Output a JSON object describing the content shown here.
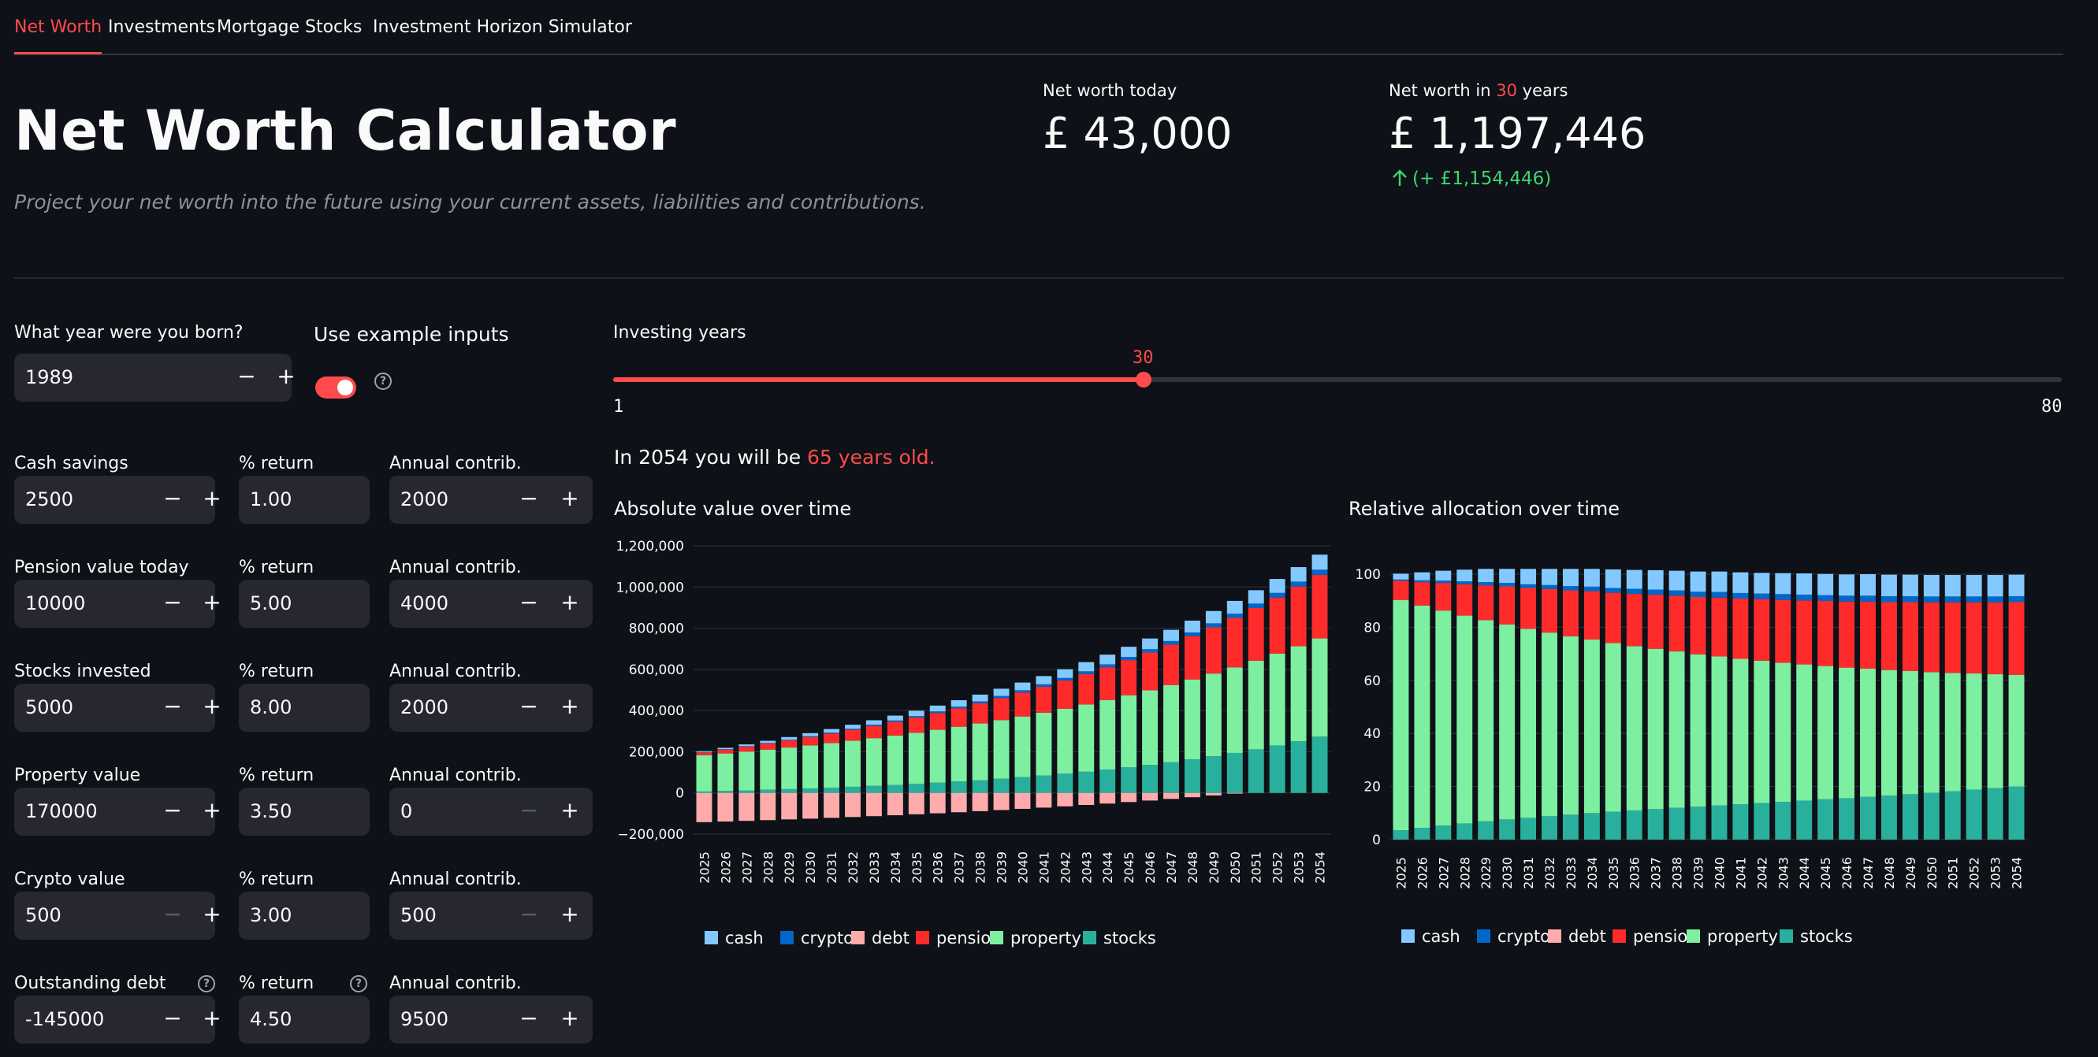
{
  "nav": {
    "tabs": [
      {
        "label": "Net Worth",
        "active": true
      },
      {
        "label": "Investments",
        "active": false
      },
      {
        "label": "Mortgage",
        "active": false
      },
      {
        "label": "Stocks",
        "active": false
      },
      {
        "label": "Investment Horizon Simulator",
        "active": false
      }
    ]
  },
  "header": {
    "title": "Net Worth Calculator",
    "subtitle": "Project your net worth into the future using your current assets, liabilities and contributions."
  },
  "metrics": {
    "today_label": "Net worth today",
    "today_value": "£ 43,000",
    "future_label_pre": "Net worth in ",
    "future_label_years": "30",
    "future_label_post": " years",
    "future_value": "£ 1,197,446",
    "future_delta": "(+ £1,154,446)"
  },
  "inputs": {
    "born_label": "What year were you born?",
    "born_value": "1989",
    "example_label": "Use example inputs",
    "example_enabled": true,
    "return_label": "% return",
    "contrib_label": "Annual contrib.",
    "rows": [
      {
        "label": "Cash savings",
        "value": "2500",
        "ret": "1.00",
        "contrib": "2000",
        "help": false
      },
      {
        "label": "Pension value today",
        "value": "10000",
        "ret": "5.00",
        "contrib": "4000",
        "help": false
      },
      {
        "label": "Stocks invested",
        "value": "5000",
        "ret": "8.00",
        "contrib": "2000",
        "help": false
      },
      {
        "label": "Property value",
        "value": "170000",
        "ret": "3.50",
        "contrib": "0",
        "help": false
      },
      {
        "label": "Crypto value",
        "value": "500",
        "ret": "3.00",
        "contrib": "500",
        "help": false
      },
      {
        "label": "Outstanding debt",
        "value": "-145000",
        "ret": "4.50",
        "contrib": "9500",
        "help": true
      }
    ]
  },
  "slider": {
    "label": "Investing years",
    "value": "30",
    "min": "1",
    "max": "80"
  },
  "age_text": {
    "pre": "In 2054 you will be ",
    "highlight": "65 years old."
  },
  "colors": {
    "accent": "#ff4b4b",
    "positive": "#3dd56d",
    "cash": "#83c9ff",
    "crypto": "#0068c9",
    "debt": "#ffabab",
    "pension": "#ff2b2b",
    "property": "#7defa1",
    "stocks": "#29b09d"
  },
  "chart_data": [
    {
      "type": "bar",
      "stacked": true,
      "title": "Absolute value over time",
      "categories": [
        "2025",
        "2026",
        "2027",
        "2028",
        "2029",
        "2030",
        "2031",
        "2032",
        "2033",
        "2034",
        "2035",
        "2036",
        "2037",
        "2038",
        "2039",
        "2040",
        "2041",
        "2042",
        "2043",
        "2044",
        "2045",
        "2046",
        "2047",
        "2048",
        "2049",
        "2050",
        "2051",
        "2052",
        "2053",
        "2054"
      ],
      "y_ticks": [
        "1,200,000",
        "1,000,000",
        "800,000",
        "600,000",
        "400,000",
        "200,000",
        "0",
        "−200,000"
      ],
      "ylim": [
        -200000,
        1200000
      ],
      "series": [
        {
          "name": "stocks",
          "values": [
            7000,
            9560,
            12325,
            15311,
            18536,
            22019,
            25780,
            29843,
            34230,
            38968,
            44086,
            49613,
            55582,
            62029,
            68991,
            76511,
            84632,
            93403,
            102875,
            113105,
            124154,
            136086,
            148974,
            162891,
            177923,
            194157,
            211690,
            230625,
            251075,
            273161
          ]
        },
        {
          "name": "property",
          "values": [
            175950,
            182108,
            188482,
            195079,
            201907,
            208974,
            216288,
            223858,
            231693,
            239802,
            248195,
            256882,
            265873,
            275178,
            284809,
            294777,
            305094,
            315772,
            326824,
            338263,
            350102,
            362355,
            375038,
            388164,
            401750,
            415811,
            430365,
            445427,
            461017,
            477153
          ]
        },
        {
          "name": "pension",
          "values": [
            14500,
            19225,
            24186,
            29395,
            34865,
            40608,
            46638,
            52970,
            59619,
            66600,
            73930,
            81627,
            89708,
            98193,
            107103,
            116458,
            126281,
            136595,
            147425,
            158796,
            170736,
            183273,
            196437,
            210259,
            224772,
            240010,
            256011,
            272811,
            290452,
            308975
          ]
        },
        {
          "name": "crypto",
          "values": [
            1015,
            1545,
            2091,
            2654,
            3233,
            3830,
            4445,
            5078,
            5731,
            6402,
            7095,
            7807,
            8542,
            9298,
            10077,
            10879,
            11705,
            12557,
            13433,
            14336,
            15266,
            16224,
            17211,
            18227,
            19274,
            20352,
            21463,
            22606,
            23785,
            24998
          ]
        },
        {
          "name": "cash",
          "values": [
            4525,
            6570,
            8636,
            10722,
            12829,
            14957,
            17107,
            19278,
            21471,
            23686,
            25923,
            28182,
            30464,
            32768,
            35096,
            37447,
            39822,
            42220,
            44642,
            47088,
            49559,
            52055,
            54575,
            57121,
            59692,
            62289,
            64912,
            67561,
            70237,
            72939
          ]
        },
        {
          "name": "debt",
          "values": [
            -142025,
            -138916,
            -135668,
            -132273,
            -128726,
            -125018,
            -121144,
            -117095,
            -112864,
            -108443,
            -103823,
            -98995,
            -93950,
            -88678,
            -83169,
            -77411,
            -71395,
            -65107,
            -58537,
            -51671,
            -44496,
            -36998,
            -29163,
            -20975,
            -12419,
            -3478,
            0,
            0,
            0,
            0
          ]
        }
      ],
      "legend": [
        "cash",
        "crypto",
        "debt",
        "pension",
        "property",
        "stocks"
      ],
      "legend_position": "bottom"
    },
    {
      "type": "bar",
      "stacked": true,
      "title": "Relative allocation over time",
      "categories": [
        "2025",
        "2026",
        "2027",
        "2028",
        "2029",
        "2030",
        "2031",
        "2032",
        "2033",
        "2034",
        "2035",
        "2036",
        "2037",
        "2038",
        "2039",
        "2040",
        "2041",
        "2042",
        "2043",
        "2044",
        "2045",
        "2046",
        "2047",
        "2048",
        "2049",
        "2050",
        "2051",
        "2052",
        "2053",
        "2054"
      ],
      "y_ticks": [
        "100",
        "80",
        "60",
        "40",
        "20",
        "0"
      ],
      "ylim": [
        0,
        100
      ],
      "series": [
        {
          "name": "stocks",
          "values": [
            3.5,
            4.4,
            5.3,
            6.1,
            6.9,
            7.6,
            8.2,
            8.8,
            9.4,
            10.0,
            10.5,
            11.0,
            11.5,
            12.0,
            12.4,
            12.9,
            13.3,
            13.8,
            14.2,
            14.7,
            15.2,
            15.6,
            16.1,
            16.6,
            17.1,
            17.6,
            18.2,
            18.8,
            19.4,
            20.0
          ]
        },
        {
          "name": "property",
          "values": [
            86.8,
            83.8,
            81.0,
            78.3,
            75.8,
            73.5,
            71.2,
            69.2,
            67.2,
            65.4,
            63.6,
            61.9,
            60.4,
            58.9,
            57.4,
            56.1,
            54.8,
            53.6,
            52.4,
            51.3,
            50.2,
            49.2,
            48.3,
            47.3,
            46.4,
            45.5,
            44.6,
            43.8,
            42.9,
            42.1
          ]
        },
        {
          "name": "pension",
          "values": [
            7.2,
            8.8,
            10.4,
            11.8,
            13.1,
            14.3,
            15.4,
            16.4,
            17.3,
            18.2,
            18.9,
            19.7,
            20.4,
            21.0,
            21.6,
            22.2,
            22.7,
            23.2,
            23.7,
            24.1,
            24.5,
            24.9,
            25.3,
            25.6,
            26.0,
            26.3,
            26.6,
            26.8,
            27.1,
            27.4
          ]
        },
        {
          "name": "crypto",
          "values": [
            0.5,
            0.7,
            0.9,
            1.1,
            1.2,
            1.3,
            1.4,
            1.5,
            1.6,
            1.7,
            1.8,
            1.9,
            1.9,
            2.0,
            2.0,
            2.1,
            2.1,
            2.1,
            2.2,
            2.2,
            2.2,
            2.2,
            2.2,
            2.2,
            2.2,
            2.2,
            2.2,
            2.2,
            2.2,
            2.2
          ]
        },
        {
          "name": "cash",
          "values": [
            2.2,
            3.0,
            3.7,
            4.4,
            5.0,
            5.3,
            5.8,
            6.1,
            6.5,
            6.7,
            7.0,
            7.1,
            7.3,
            7.4,
            7.6,
            7.7,
            7.8,
            7.8,
            7.9,
            8.0,
            8.0,
            8.0,
            8.1,
            8.1,
            8.1,
            8.1,
            8.1,
            8.1,
            8.1,
            8.1
          ]
        }
      ],
      "legend": [
        "cash",
        "crypto",
        "debt",
        "pension",
        "property",
        "stocks"
      ],
      "legend_position": "bottom"
    }
  ]
}
